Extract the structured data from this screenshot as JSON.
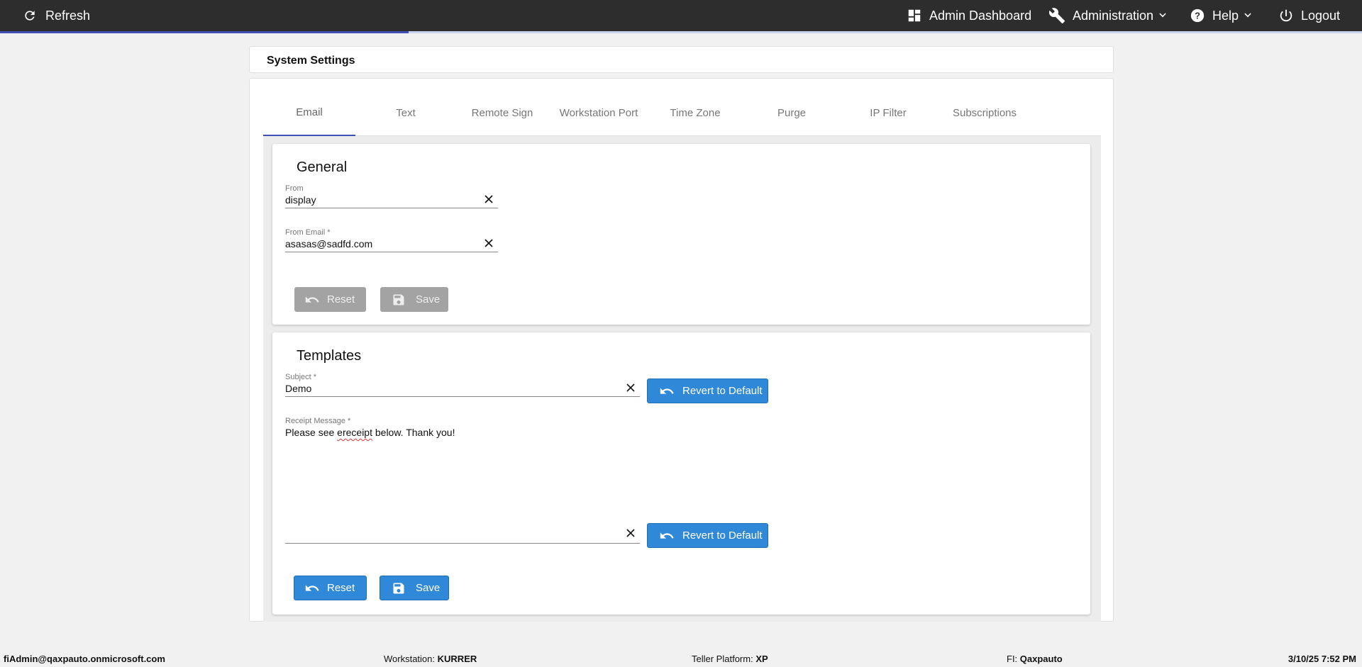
{
  "topbar": {
    "refresh_label": "Refresh",
    "dashboard_label": "Admin Dashboard",
    "administration_label": "Administration",
    "help_label": "Help",
    "logout_label": "Logout",
    "progress_fraction": 0.3
  },
  "page": {
    "title": "System Settings"
  },
  "tabs": [
    {
      "label": "Email",
      "active": true
    },
    {
      "label": "Text",
      "active": false
    },
    {
      "label": "Remote Sign",
      "active": false
    },
    {
      "label": "Workstation Port",
      "active": false
    },
    {
      "label": "Time Zone",
      "active": false
    },
    {
      "label": "Purge",
      "active": false
    },
    {
      "label": "IP Filter",
      "active": false
    },
    {
      "label": "Subscriptions",
      "active": false
    }
  ],
  "general": {
    "title": "General",
    "from": {
      "label": "From",
      "value": "display"
    },
    "from_email": {
      "label": "From Email *",
      "value": "asasas@sadfd.com"
    },
    "reset_label": "Reset",
    "save_label": "Save"
  },
  "templates": {
    "title": "Templates",
    "subject": {
      "label": "Subject *",
      "value": "Demo"
    },
    "receipt_message": {
      "label": "Receipt Message *",
      "value_before": "Please see ",
      "value_misspelled": "ereceipt",
      "value_after": " below. Thank you!"
    },
    "revert_label": "Revert to Default",
    "reset_label": "Reset",
    "save_label": "Save"
  },
  "footer": {
    "user": "fiAdmin@qaxpauto.onmicrosoft.com",
    "workstation_label": "Workstation:",
    "workstation_value": "KURRER",
    "teller_label": "Teller Platform:",
    "teller_value": "XP",
    "fi_label": "FI:",
    "fi_value": "Qaxpauto",
    "datetime": "3/10/25 7:52 PM"
  },
  "colors": {
    "topbar": "#2d2d2d",
    "accent": "#3f51b5",
    "primary_button": "#2f89d8",
    "disabled_button": "#a3a3a3"
  }
}
